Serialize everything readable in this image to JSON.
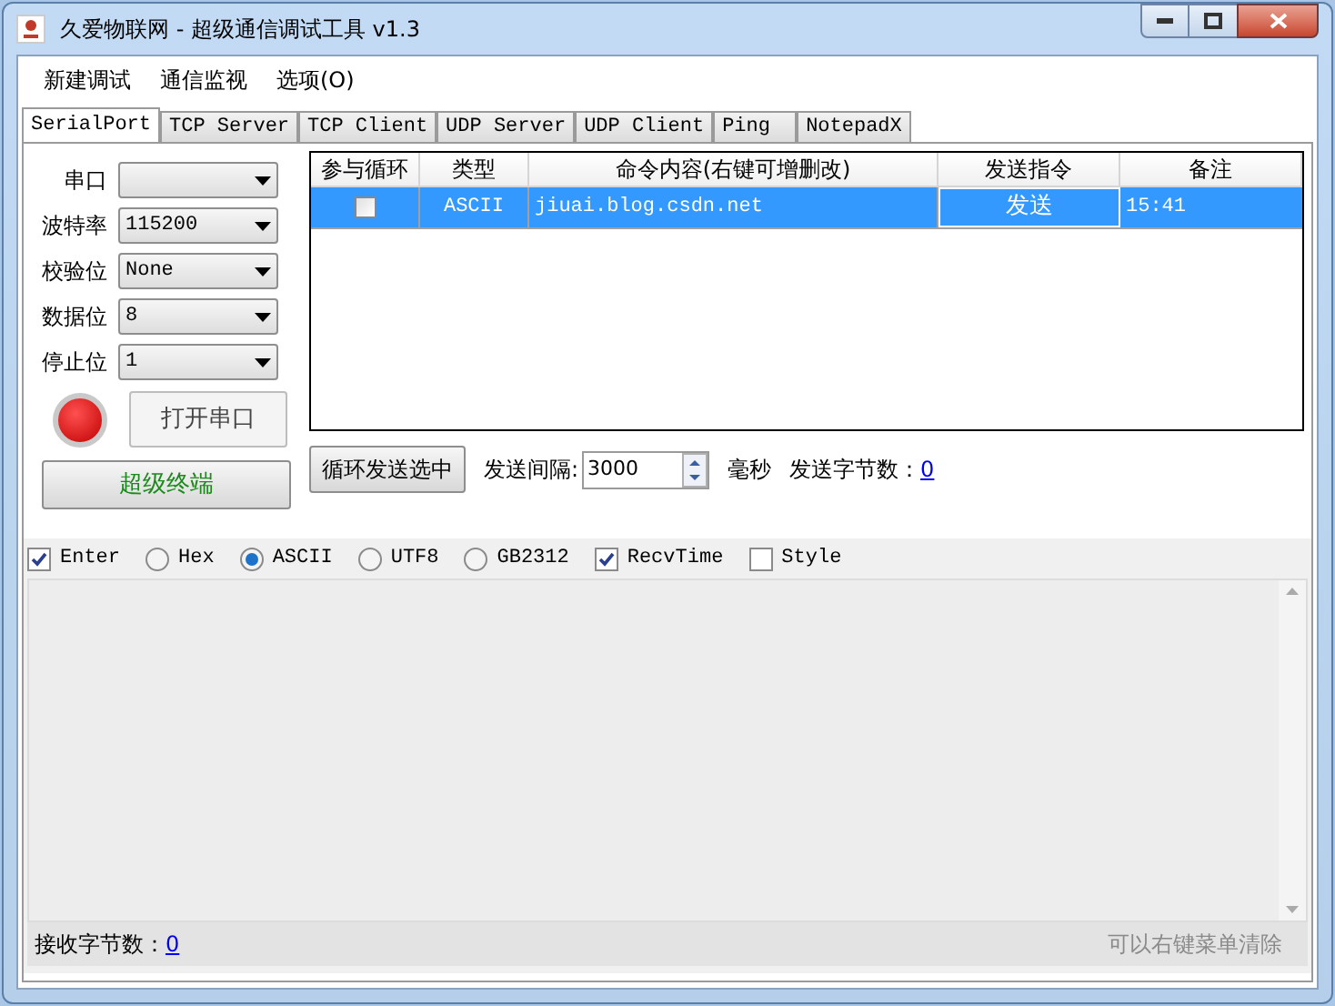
{
  "window": {
    "title": "久爱物联网 - 超级通信调试工具 v1.3"
  },
  "menu": [
    "新建调试",
    "通信监视",
    "选项(O)"
  ],
  "tabs": [
    {
      "label": "SerialPort",
      "selected": true
    },
    {
      "label": "TCP Server",
      "selected": false
    },
    {
      "label": "TCP Client",
      "selected": false
    },
    {
      "label": "UDP Server",
      "selected": false
    },
    {
      "label": "UDP Client",
      "selected": false
    },
    {
      "label": "Ping",
      "selected": false
    },
    {
      "label": "NotepadX",
      "selected": false
    }
  ],
  "serial_settings": [
    {
      "label": "串口"
    },
    {
      "label": "波特率",
      "value": "115200"
    },
    {
      "label": "校验位",
      "value": "None"
    },
    {
      "label": "数据位",
      "value": "8"
    },
    {
      "label": "停止位",
      "value": "1"
    }
  ],
  "port_indicator": {
    "on": false
  },
  "open_port_button": "打开串口",
  "terminal_button": "超级终端",
  "table": {
    "columns": [
      "参与循环",
      "类型",
      "命令内容(右键可增删改)",
      "发送指令",
      "备注"
    ],
    "rows": [
      {
        "selected": true,
        "loop": false,
        "type": "ASCII",
        "command": "jiuai.blog.csdn.net",
        "send": "发送",
        "note": "15:41"
      }
    ]
  },
  "send_bar": {
    "loop_button": "循环发送选中",
    "interval_label": "发送间隔:",
    "interval": "3000",
    "unit": "毫秒",
    "sent_label": "发送字节数：",
    "sent_count": "0"
  },
  "options": [
    {
      "kind": "checkbox",
      "label": "Enter",
      "checked": true
    },
    {
      "kind": "radio",
      "label": "Hex",
      "selected": false
    },
    {
      "kind": "radio",
      "label": "ASCII",
      "selected": true
    },
    {
      "kind": "radio",
      "label": "UTF8",
      "selected": false
    },
    {
      "kind": "radio",
      "label": "GB2312",
      "selected": false
    },
    {
      "kind": "checkbox",
      "label": "RecvTime",
      "checked": true
    },
    {
      "kind": "checkbox",
      "label": "Style",
      "checked": false
    }
  ],
  "footer": {
    "received_label": "接收字节数：",
    "received_count": "0",
    "hint": "可以右键菜单清除"
  }
}
